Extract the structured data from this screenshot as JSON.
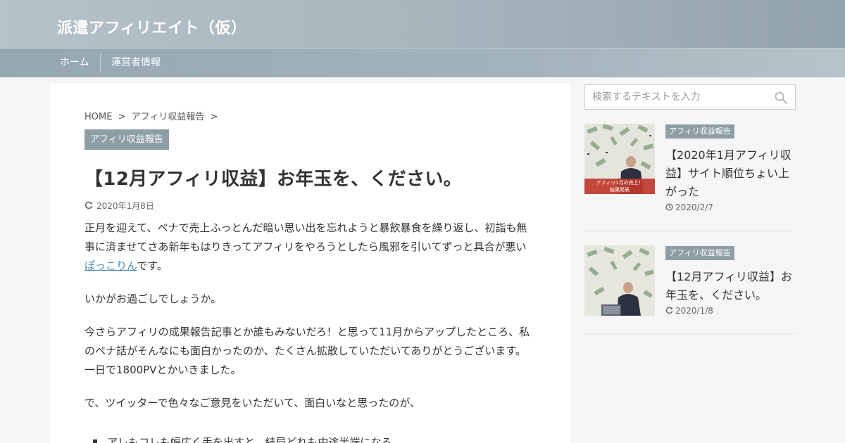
{
  "header": {
    "site_title": "派遣アフィリエイト（仮）"
  },
  "nav": {
    "items": [
      {
        "label": "ホーム"
      },
      {
        "label": "運営者情報"
      }
    ]
  },
  "breadcrumb": {
    "home": "HOME",
    "sep": ">",
    "category": "アフィリ収益報告"
  },
  "post": {
    "category": "アフィリ収益報告",
    "title": "【12月アフィリ収益】お年玉を、ください。",
    "date": "2020年1月8日",
    "p1_text": "正月を迎えて、ペナで売上ふっとんだ暗い思い出を忘れようと暴飲暴食を繰り返し、初詣も無事に済ませてさあ新年もはりきってアフィリをやろうとしたら風邪を引いてずっと具合が悪い",
    "p1_link": "ぽっこりん",
    "p1_suffix": "です。",
    "p2": "いかがお過ごしでしょうか。",
    "p3": "今さらアフィリの成果報告記事とか誰もみないだろ！と思って11月からアップしたところ、私のペナ話がそんなにも面白かったのか、たくさん拡散していただいてありがとうございます。一日で1800PVとかいきました。",
    "p4": "で、ツイッターで色々なご意見をいただいて、面白いなと思ったのが、",
    "p5_bullet": "アレもコレも幅広く手を出すと、結局どれも中途半端になる"
  },
  "sidebar": {
    "search_placeholder": "検索するテキストを入力",
    "posts": [
      {
        "category": "アフィリ収益報告",
        "title": "【2020年1月アフィリ収益】サイト順位ちょい上がった",
        "date": "2020/2/7",
        "date_icon": "clock-icon",
        "thumb_caption1": "アフィリ1月の売上！",
        "thumb_caption2": "結果発表"
      },
      {
        "category": "アフィリ収益報告",
        "title": "【12月アフィリ収益】お年玉を、ください。",
        "date": "2020/1/8",
        "date_icon": "refresh-icon"
      }
    ]
  },
  "colors": {
    "badge": "#8e9ea6",
    "link": "#4c8bbf",
    "header": "#a7b5bd"
  }
}
